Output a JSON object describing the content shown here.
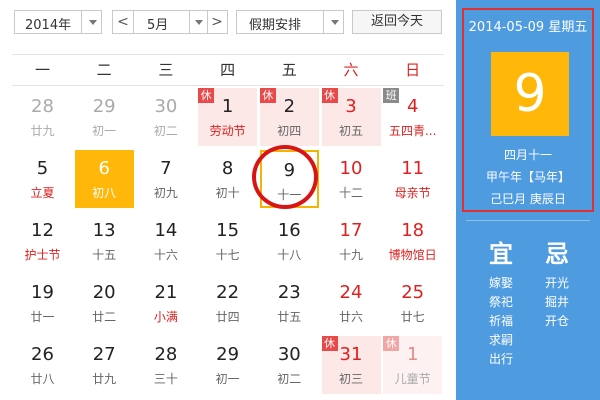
{
  "toolbar": {
    "year": "2014年",
    "month": "5月",
    "prev_symbol": "<",
    "next_symbol": ">",
    "holiday": "假期安排",
    "today_label": "返回今天"
  },
  "weekdays": [
    "一",
    "二",
    "三",
    "四",
    "五",
    "六",
    "日"
  ],
  "calendar": {
    "rows": [
      [
        {
          "day": "28",
          "lunar": "廿九",
          "other": true
        },
        {
          "day": "29",
          "lunar": "初一",
          "other": true
        },
        {
          "day": "30",
          "lunar": "初二",
          "other": true
        },
        {
          "day": "1",
          "lunar": "劳动节",
          "badge": "休",
          "holiday": true,
          "festival": true
        },
        {
          "day": "2",
          "lunar": "初四",
          "badge": "休",
          "holiday": true
        },
        {
          "day": "3",
          "lunar": "初五",
          "badge": "休",
          "holiday": true
        },
        {
          "day": "4",
          "lunar": "五四青...",
          "badge": "班",
          "workday": true,
          "festival": true
        }
      ],
      [
        {
          "day": "5",
          "lunar": "立夏",
          "festival": true
        },
        {
          "day": "6",
          "lunar": "初八",
          "selected": true
        },
        {
          "day": "7",
          "lunar": "初九"
        },
        {
          "day": "8",
          "lunar": "初十"
        },
        {
          "day": "9",
          "lunar": "十一",
          "today": true
        },
        {
          "day": "10",
          "lunar": "十二"
        },
        {
          "day": "11",
          "lunar": "母亲节",
          "festival": true
        }
      ],
      [
        {
          "day": "12",
          "lunar": "护士节",
          "festival": true
        },
        {
          "day": "13",
          "lunar": "十五"
        },
        {
          "day": "14",
          "lunar": "十六"
        },
        {
          "day": "15",
          "lunar": "十七"
        },
        {
          "day": "16",
          "lunar": "十八"
        },
        {
          "day": "17",
          "lunar": "十九"
        },
        {
          "day": "18",
          "lunar": "博物馆日",
          "festival": true
        }
      ],
      [
        {
          "day": "19",
          "lunar": "廿一"
        },
        {
          "day": "20",
          "lunar": "廿二"
        },
        {
          "day": "21",
          "lunar": "小满",
          "festival": true
        },
        {
          "day": "22",
          "lunar": "廿四"
        },
        {
          "day": "23",
          "lunar": "廿五"
        },
        {
          "day": "24",
          "lunar": "廿六"
        },
        {
          "day": "25",
          "lunar": "廿七"
        }
      ],
      [
        {
          "day": "26",
          "lunar": "廿八"
        },
        {
          "day": "27",
          "lunar": "廿九"
        },
        {
          "day": "28",
          "lunar": "三十"
        },
        {
          "day": "29",
          "lunar": "初一"
        },
        {
          "day": "30",
          "lunar": "初二"
        },
        {
          "day": "31",
          "lunar": "初三",
          "badge": "休",
          "holiday": true
        },
        {
          "day": "1",
          "lunar": "儿童节",
          "badge": "休",
          "holiday": true,
          "other": true,
          "festival": true
        }
      ]
    ]
  },
  "panel": {
    "header": "2014-05-09 星期五",
    "day": "9",
    "lunar_date": "四月十一",
    "ganzhi_year": "甲午年【马年】",
    "ganzhi_day": "己巳月 庚辰日",
    "yi_title": "宜",
    "ji_title": "忌",
    "yi": [
      "嫁娶",
      "祭祀",
      "祈福",
      "求嗣",
      "出行"
    ],
    "ji": [
      "开光",
      "掘井",
      "开仓"
    ]
  },
  "colors": {
    "accent": "#ffb70a",
    "panel_bg": "#4f9be0",
    "weekend_red": "#e02020",
    "holiday_bg": "#fde8e8",
    "highlight_circle": "#d71515"
  }
}
